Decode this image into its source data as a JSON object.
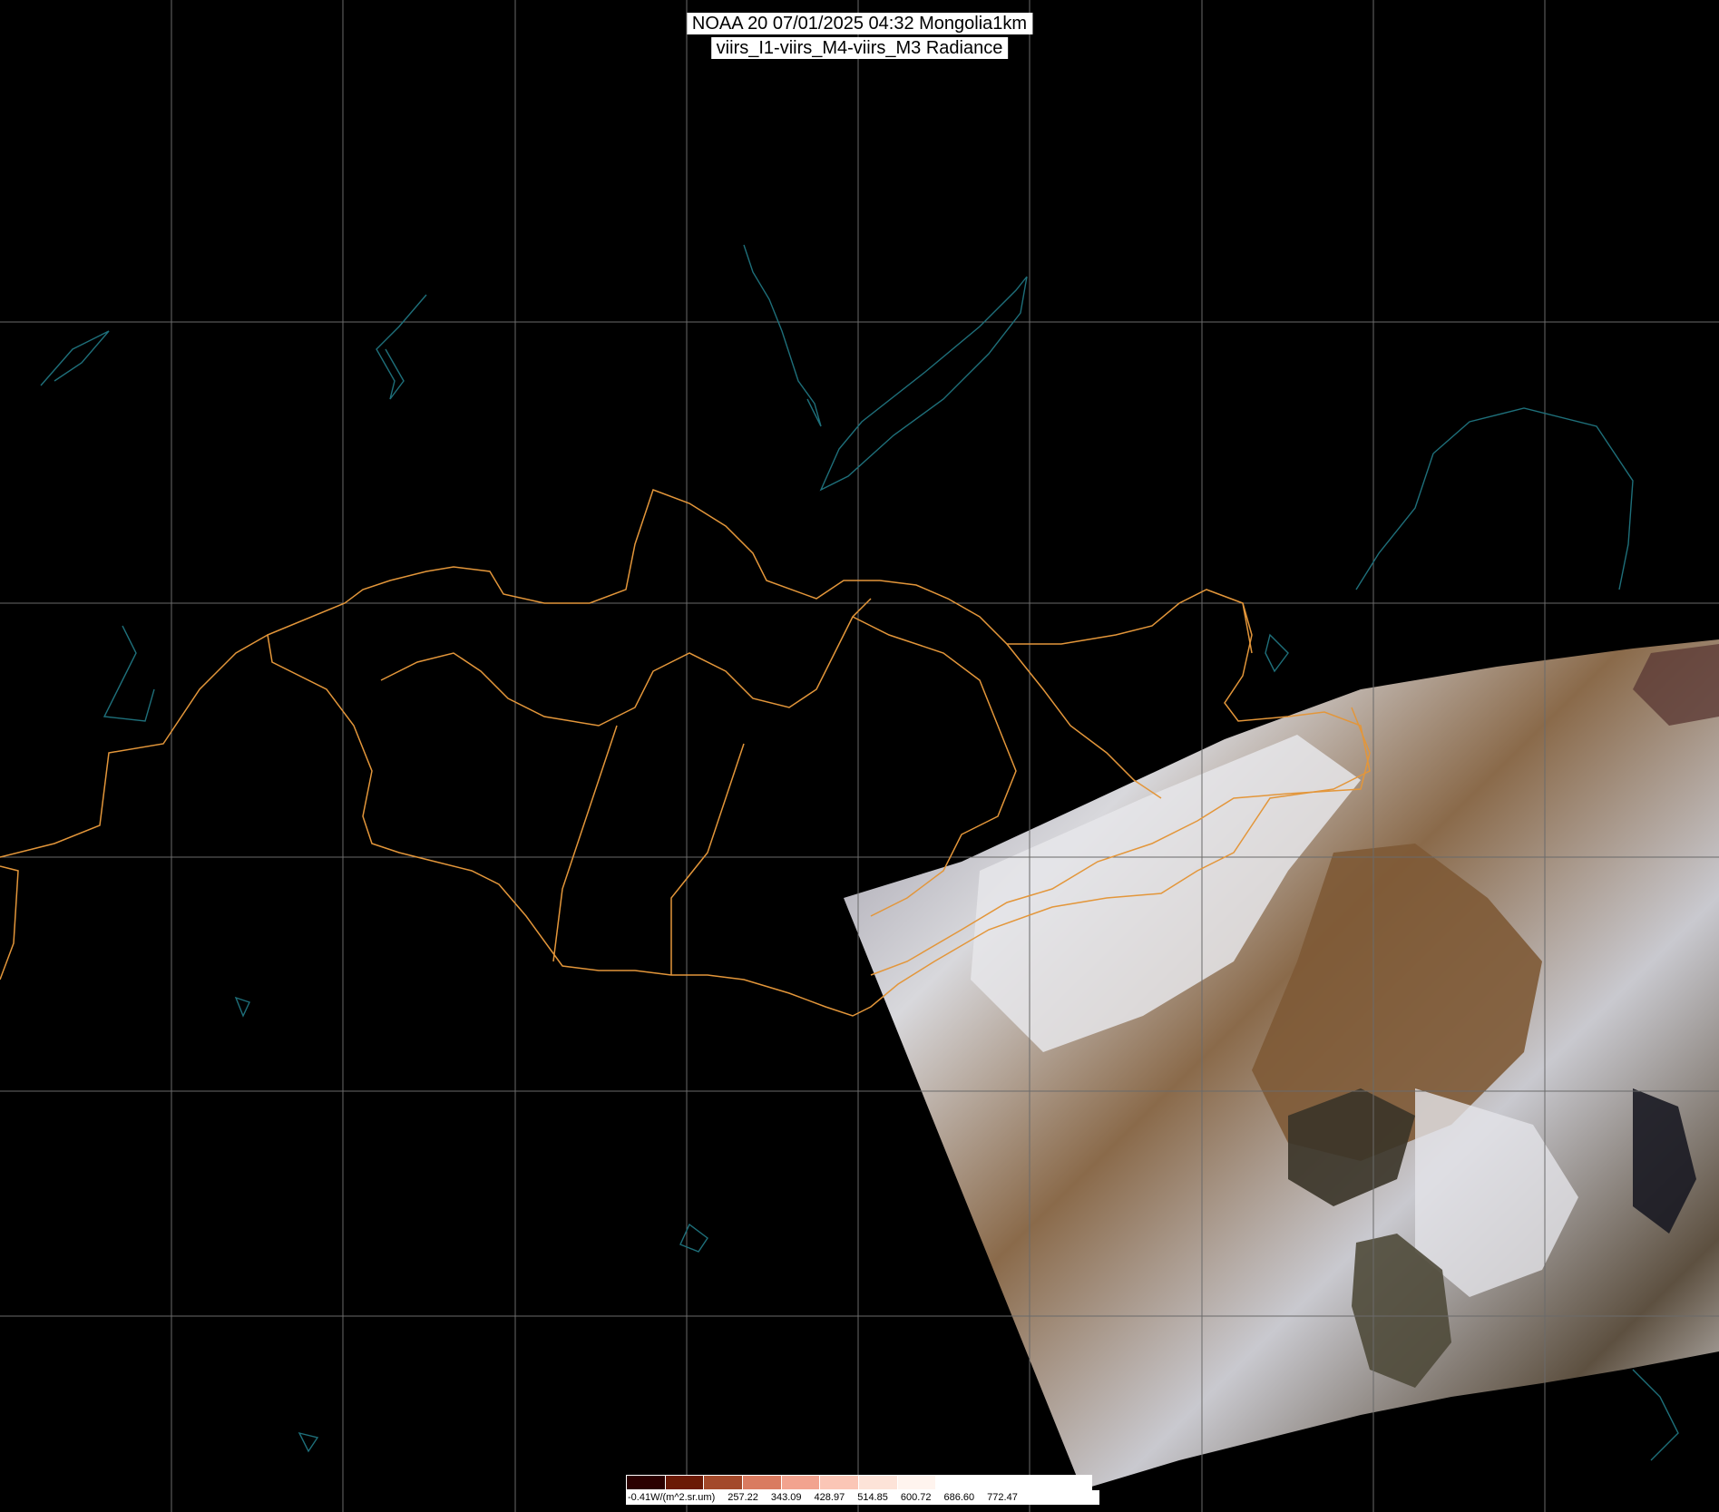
{
  "title": {
    "line1": "NOAA 20 07/01/2025 04:32 Mongolia1km",
    "line2": "viirs_I1-viirs_M4-viirs_M3 Radiance"
  },
  "colorbar": {
    "labels": [
      "-0.41W/(m^2.sr.um)",
      "257.22",
      "343.09",
      "428.97",
      "514.85",
      "600.72",
      "686.60",
      "772.47"
    ],
    "colors": [
      "#2b0000",
      "#6b1a06",
      "#a3492a",
      "#d97b60",
      "#f2a38f",
      "#fbc6b6",
      "#fde3d8",
      "#fff4ee",
      "#ffffff",
      "#ffffff",
      "#ffffff",
      "#ffffff"
    ]
  },
  "colors": {
    "background": "#000000",
    "border": "#e3963a",
    "coast": "#1e6f7a",
    "grid": "#6a6a6a"
  }
}
